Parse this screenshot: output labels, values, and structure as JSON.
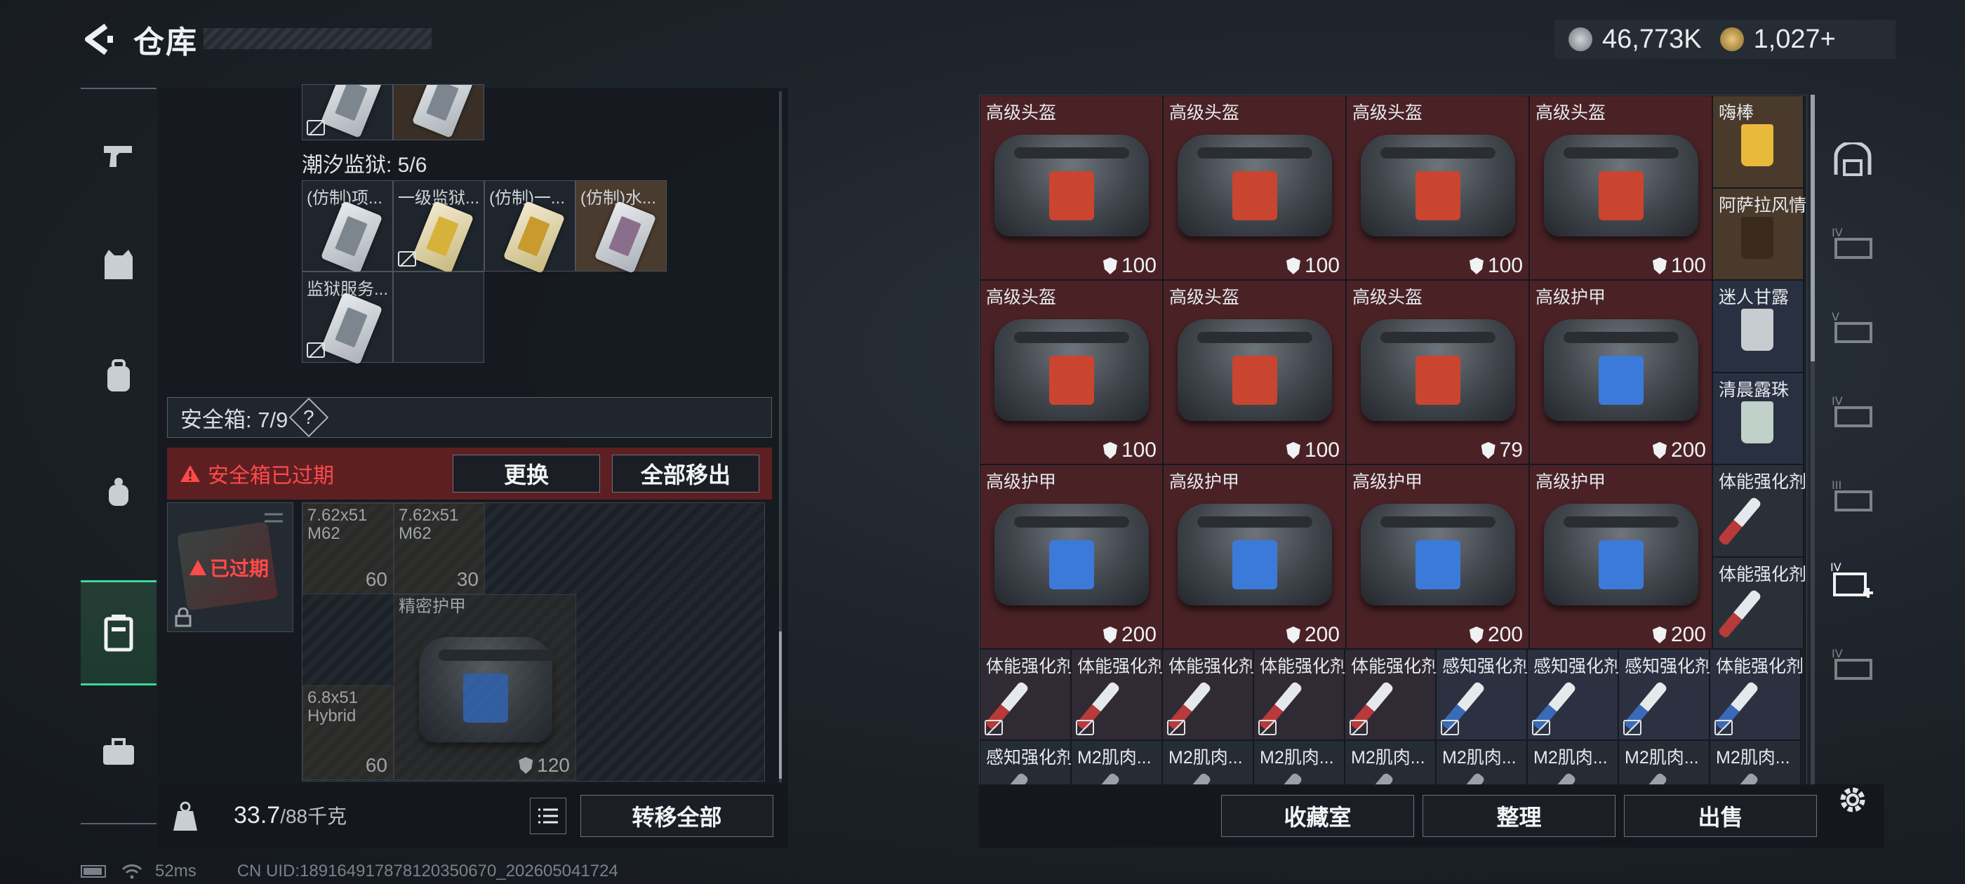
{
  "header": {
    "title": "仓库",
    "gold": "46,773K",
    "bonds": "1,027+"
  },
  "left": {
    "prison_label": "潮汐监狱: 5/6",
    "slots": [
      {
        "label": "(仿制)项...",
        "locked": false
      },
      {
        "label": "一级监狱...",
        "locked": true
      },
      {
        "label": "(仿制)一...",
        "locked": false
      },
      {
        "label": "(仿制)水...",
        "locked": false
      },
      {
        "label": "监狱服务...",
        "locked": true
      }
    ],
    "safe_box_label": "安全箱: 7/9",
    "help": "?",
    "expired_warning": "安全箱已过期",
    "replace_btn": "更换",
    "remove_all_btn": "全部移出",
    "case_status": "已过期",
    "ammo": [
      {
        "name": "7.62x51",
        "sub": "M62",
        "count": "60"
      },
      {
        "name": "7.62x51",
        "sub": "M62",
        "count": "30"
      },
      {
        "name": "6.8x51",
        "sub": "Hybrid",
        "count": "60"
      }
    ],
    "armor": {
      "name": "精密护甲",
      "durability": "120"
    },
    "weight_current": "33.7",
    "weight_max": "/88千克",
    "transfer_all_btn": "转移全部"
  },
  "inventory": {
    "bags": [
      {
        "label": "高级头盔",
        "dur": "100",
        "type": "helmet"
      },
      {
        "label": "高级头盔",
        "dur": "100",
        "type": "helmet"
      },
      {
        "label": "高级头盔",
        "dur": "100",
        "type": "helmet"
      },
      {
        "label": "高级头盔",
        "dur": "100",
        "type": "helmet"
      },
      {
        "label": "高级头盔",
        "dur": "100",
        "type": "helmet"
      },
      {
        "label": "高级头盔",
        "dur": "100",
        "type": "helmet"
      },
      {
        "label": "高级头盔",
        "dur": "79",
        "type": "helmet"
      },
      {
        "label": "高级护甲",
        "dur": "200",
        "type": "armor"
      },
      {
        "label": "高级护甲",
        "dur": "200",
        "type": "armor"
      },
      {
        "label": "高级护甲",
        "dur": "200",
        "type": "armor"
      },
      {
        "label": "高级护甲",
        "dur": "200",
        "type": "armor"
      },
      {
        "label": "高级护甲",
        "dur": "200",
        "type": "armor"
      }
    ],
    "side": [
      {
        "label": "嗨棒",
        "kind": "drink-yellow"
      },
      {
        "label": "阿萨拉风情",
        "kind": "drink-dark"
      },
      {
        "label": "迷人甘露",
        "kind": "drink-clear"
      },
      {
        "label": "清晨露珠",
        "kind": "drink-green"
      },
      {
        "label": "体能强化剂",
        "kind": "syringe-red"
      },
      {
        "label": "体能强化剂",
        "kind": "syringe-red"
      }
    ],
    "row5": [
      {
        "label": "体能强化剂",
        "kind": "syringe-red"
      },
      {
        "label": "体能强化剂",
        "kind": "syringe-red"
      },
      {
        "label": "体能强化剂",
        "kind": "syringe-red"
      },
      {
        "label": "体能强化剂",
        "kind": "syringe-red"
      },
      {
        "label": "体能强化剂",
        "kind": "syringe-red"
      },
      {
        "label": "感知强化剂",
        "kind": "syringe-blue"
      },
      {
        "label": "感知强化剂",
        "kind": "syringe-blue"
      },
      {
        "label": "感知强化剂",
        "kind": "syringe-blue"
      },
      {
        "label": "体能强化剂",
        "kind": "syringe-blue"
      }
    ],
    "row6": [
      {
        "label": "感知强化剂"
      },
      {
        "label": "M2肌肉..."
      },
      {
        "label": "M2肌肉..."
      },
      {
        "label": "M2肌肉..."
      },
      {
        "label": "M2肌肉..."
      },
      {
        "label": "M2肌肉..."
      },
      {
        "label": "M2肌肉..."
      },
      {
        "label": "M2肌肉..."
      },
      {
        "label": "M2肌肉..."
      }
    ]
  },
  "bottom": {
    "collection_btn": "收藏室",
    "sort_btn": "整理",
    "sell_btn": "出售"
  },
  "status": {
    "ping": "52ms",
    "uid": "CN UID:18916491787812035067​0_202605041724"
  },
  "colors": {
    "accent": "#3fd69b",
    "warning": "#ff4a4a",
    "helmet_patch": "#c9452f",
    "armor_patch": "#3b7ad9"
  }
}
